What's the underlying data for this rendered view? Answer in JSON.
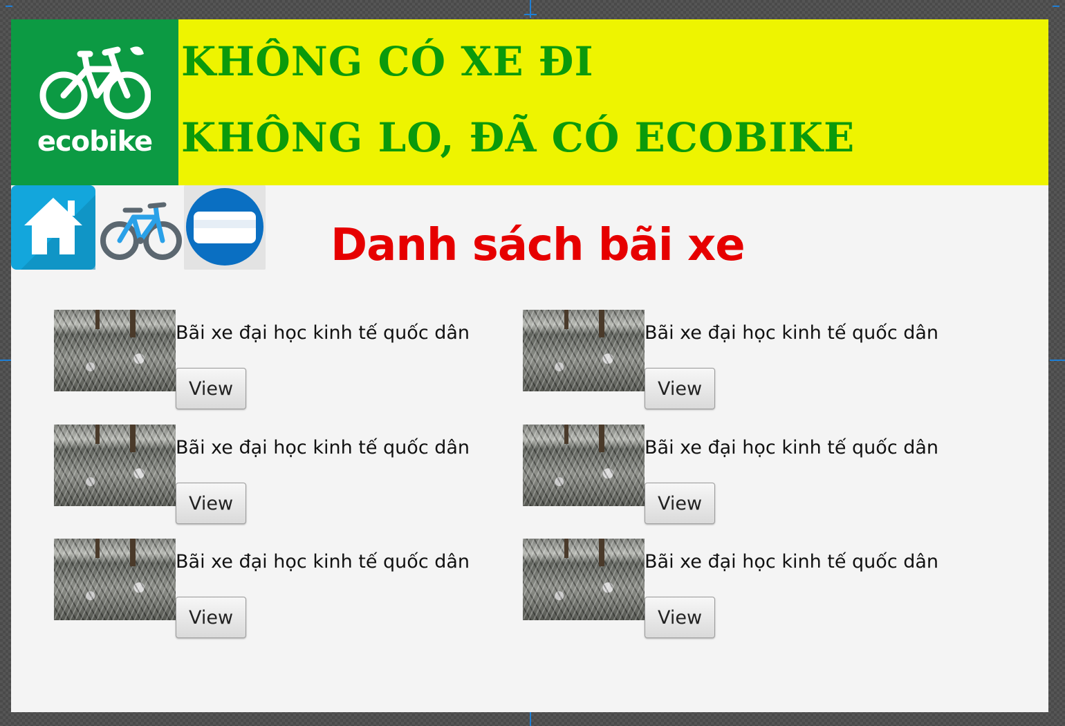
{
  "header": {
    "logo_text": "ecobike",
    "slogan_line1": "KHÔNG CÓ XE ĐI",
    "slogan_line2": "KHÔNG LO, ĐÃ CÓ ECOBIKE"
  },
  "nav": {
    "icons": [
      "home-icon",
      "bicycle-icon",
      "card-icon"
    ]
  },
  "page": {
    "title": "Danh sách bãi xe"
  },
  "stations": [
    {
      "name": "Bãi xe đại học kinh tế quốc dân",
      "button": "View"
    },
    {
      "name": "Bãi xe đại học kinh tế quốc dân",
      "button": "View"
    },
    {
      "name": "Bãi xe đại học kinh tế quốc dân",
      "button": "View"
    },
    {
      "name": "Bãi xe đại học kinh tế quốc dân",
      "button": "View"
    },
    {
      "name": "Bãi xe đại học kinh tế quốc dân",
      "button": "View"
    },
    {
      "name": "Bãi xe đại học kinh tế quốc dân",
      "button": "View"
    }
  ],
  "colors": {
    "banner_bg": "#eef400",
    "slogan": "#0b9a0b",
    "logo_bg": "#0c9a43",
    "title": "#e60000",
    "home_button": "#13a6dc",
    "bike_blue": "#2aa1e8",
    "card_blue": "#0a6fc2"
  }
}
